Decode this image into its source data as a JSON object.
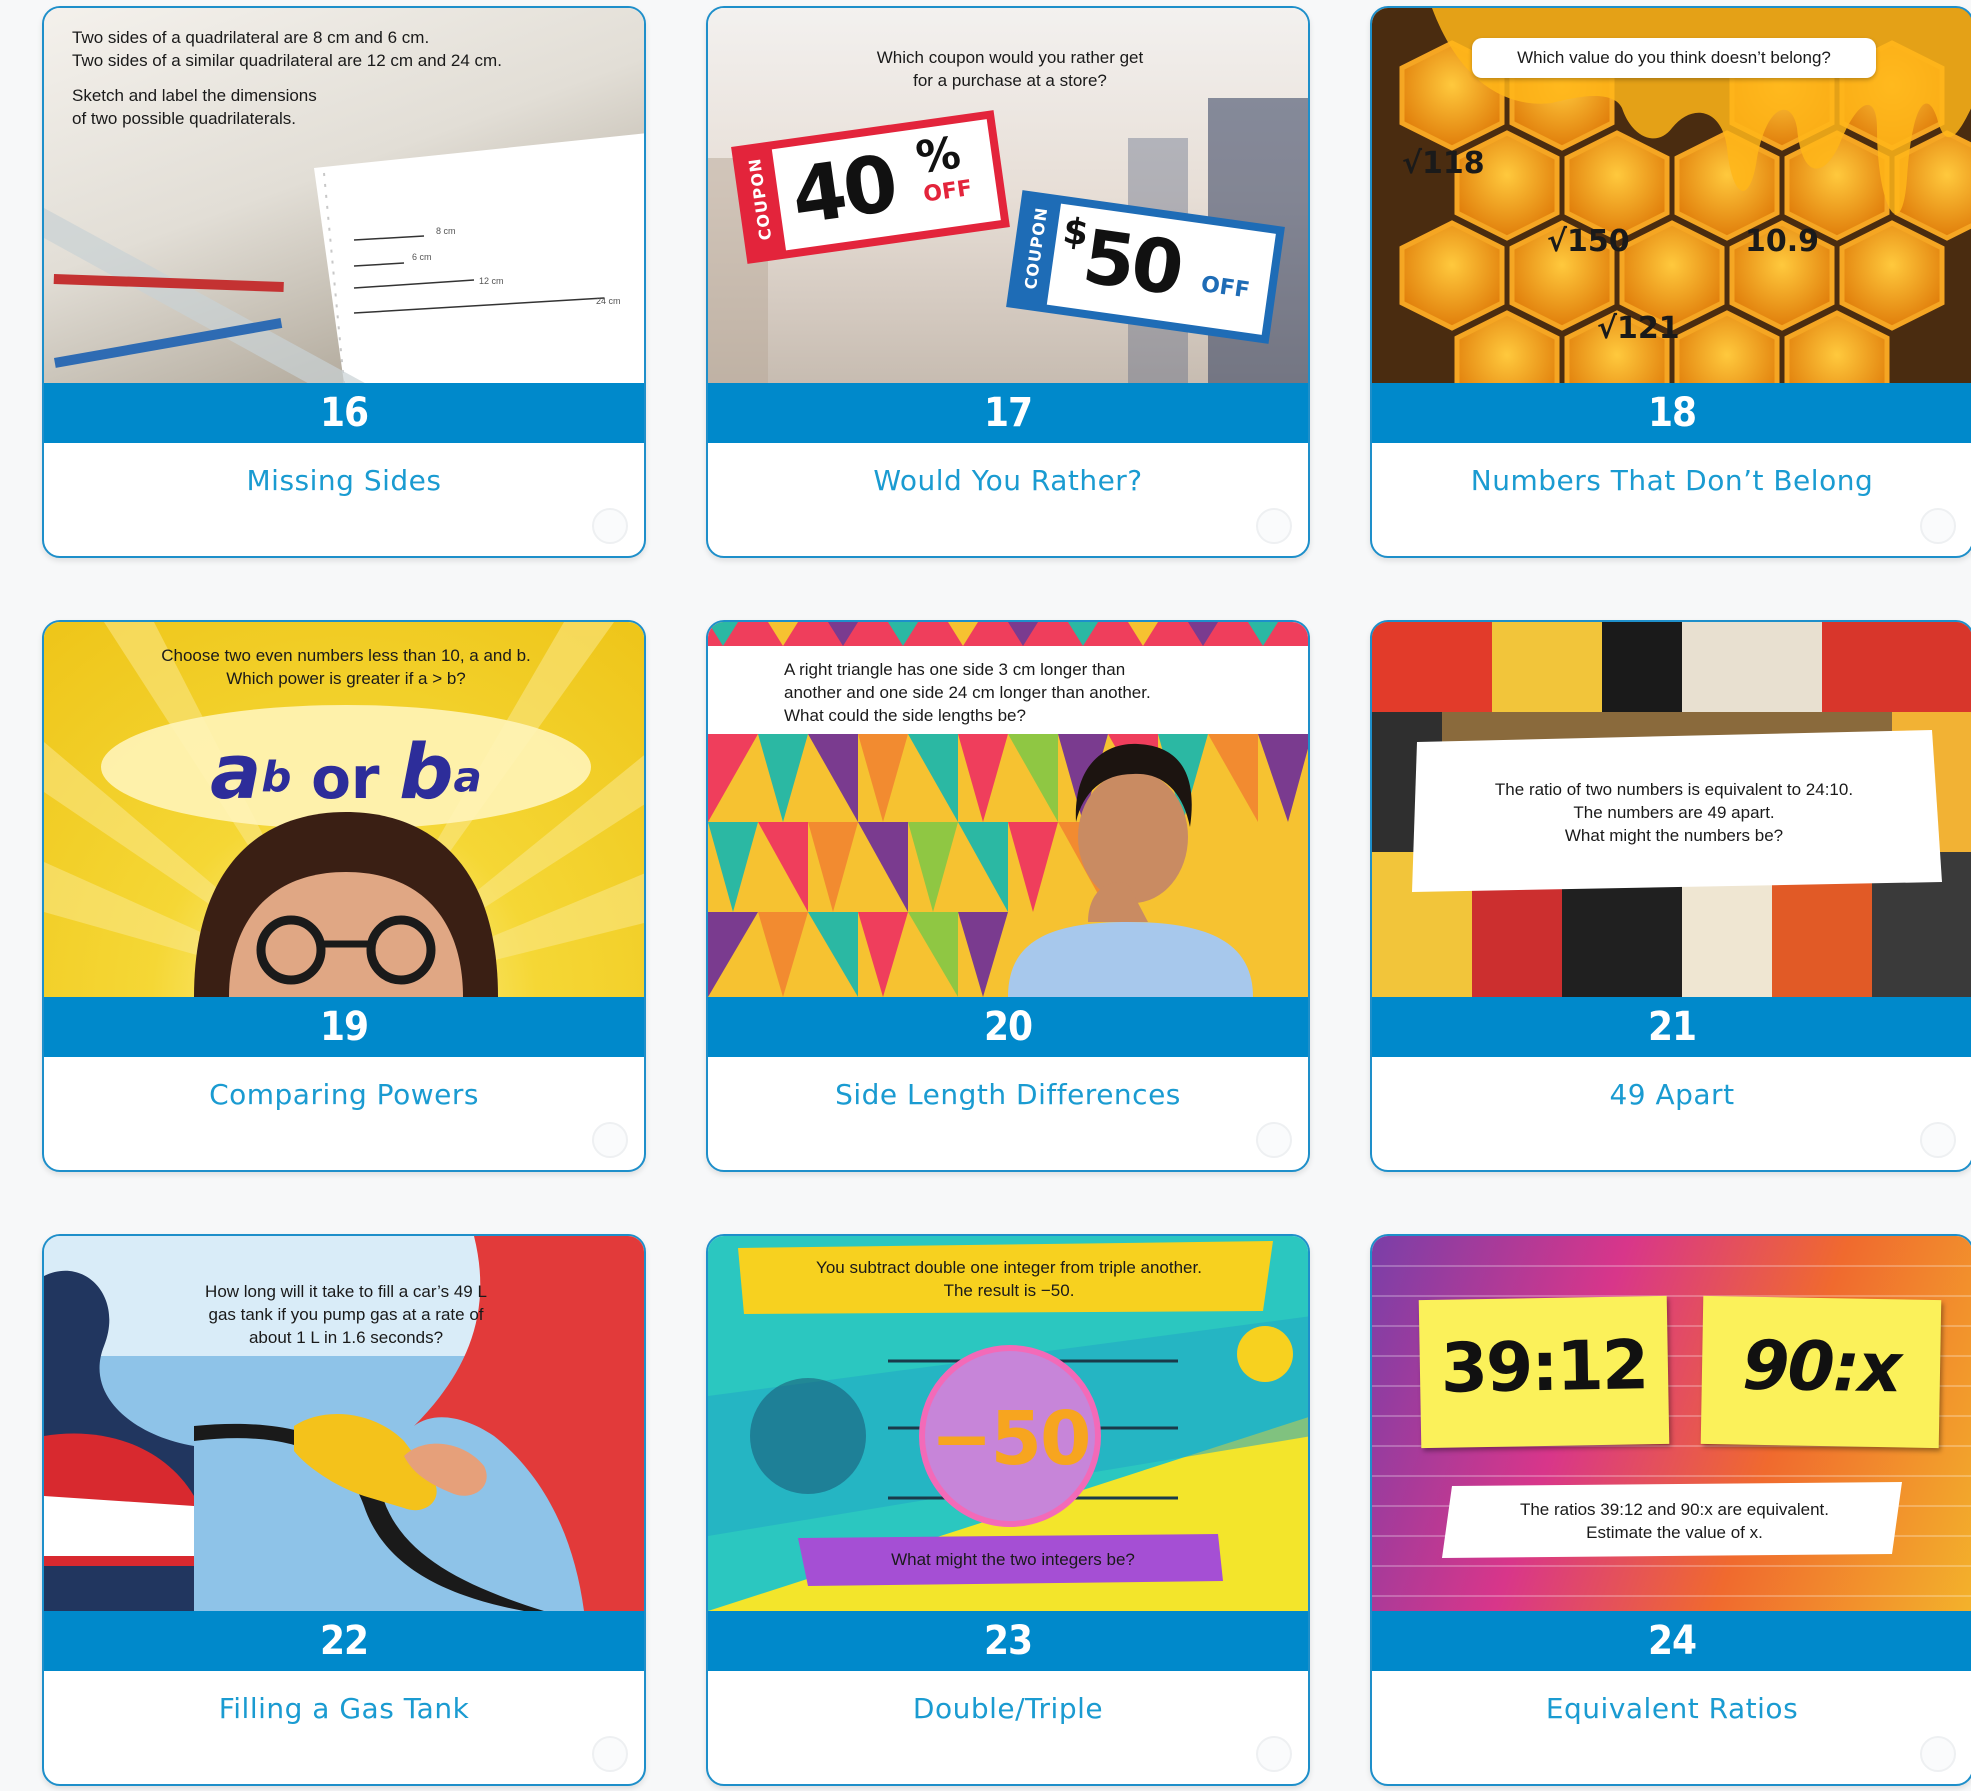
{
  "cards": [
    {
      "number": "16",
      "title": "Missing Sides",
      "prompt": {
        "line1": "Two sides of a quadrilateral are 8 cm and 6 cm.",
        "line2": "Two sides of a similar quadrilateral are 12 cm and 24 cm.",
        "line3": "Sketch and label the dimensions",
        "line4": "of two possible quadrilaterals."
      },
      "sketch_labels": [
        "8 cm",
        "6 cm",
        "12 cm",
        "24 cm"
      ]
    },
    {
      "number": "17",
      "title": "Would You Rather?",
      "prompt": {
        "line1": "Which coupon would you rather get",
        "line2": "for a purchase at a store?"
      },
      "coupon_a": {
        "tag": "COUPON",
        "value": "40",
        "unit": "%",
        "off": "OFF"
      },
      "coupon_b": {
        "tag": "COUPON",
        "currency": "$",
        "value": "50",
        "off": "OFF"
      }
    },
    {
      "number": "18",
      "title": "Numbers That Don’t Belong",
      "prompt": {
        "line1": "Which value do you think doesn’t belong?"
      },
      "values": [
        "√118",
        "√150",
        "10.9",
        "√121"
      ]
    },
    {
      "number": "19",
      "title": "Comparing Powers",
      "prompt": {
        "line1": "Choose two even numbers less than 10, a and b.",
        "line2": "Which power is greater if a > b?"
      },
      "expression": {
        "left_base": "a",
        "left_exp": "b",
        "or": "or",
        "right_base": "b",
        "right_exp": "a"
      }
    },
    {
      "number": "20",
      "title": "Side Length Differences",
      "prompt": {
        "line1": "A right triangle has one side 3 cm longer than",
        "line2": "another and one side 24 cm longer than another.",
        "line3": "What could the side lengths be?"
      }
    },
    {
      "number": "21",
      "title": "49 Apart",
      "prompt": {
        "line1": "The ratio of two numbers is equivalent to 24:10.",
        "line2": "The numbers are 49 apart.",
        "line3": "What might the numbers be?"
      }
    },
    {
      "number": "22",
      "title": "Filling a Gas Tank",
      "prompt": {
        "line1": "How long will it take to fill a car’s 49 L",
        "line2": "gas tank if you pump gas at a rate of",
        "line3": "about 1 L in 1.6 seconds?"
      }
    },
    {
      "number": "23",
      "title": "Double/Triple",
      "prompt": {
        "line1": "You subtract double one integer from triple another.",
        "line2": "The result is −50.",
        "line3": "What might the two integers be?"
      },
      "value": "−50"
    },
    {
      "number": "24",
      "title": "Equivalent Ratios",
      "ratio_a": "39:12",
      "ratio_b": "90:x",
      "prompt": {
        "line1": "The ratios 39:12 and 90:x are equivalent.",
        "line2": "Estimate the value of x."
      }
    }
  ],
  "colors": {
    "accent": "#0089cb",
    "title": "#1a9bd1",
    "border": "#1e8fca"
  }
}
